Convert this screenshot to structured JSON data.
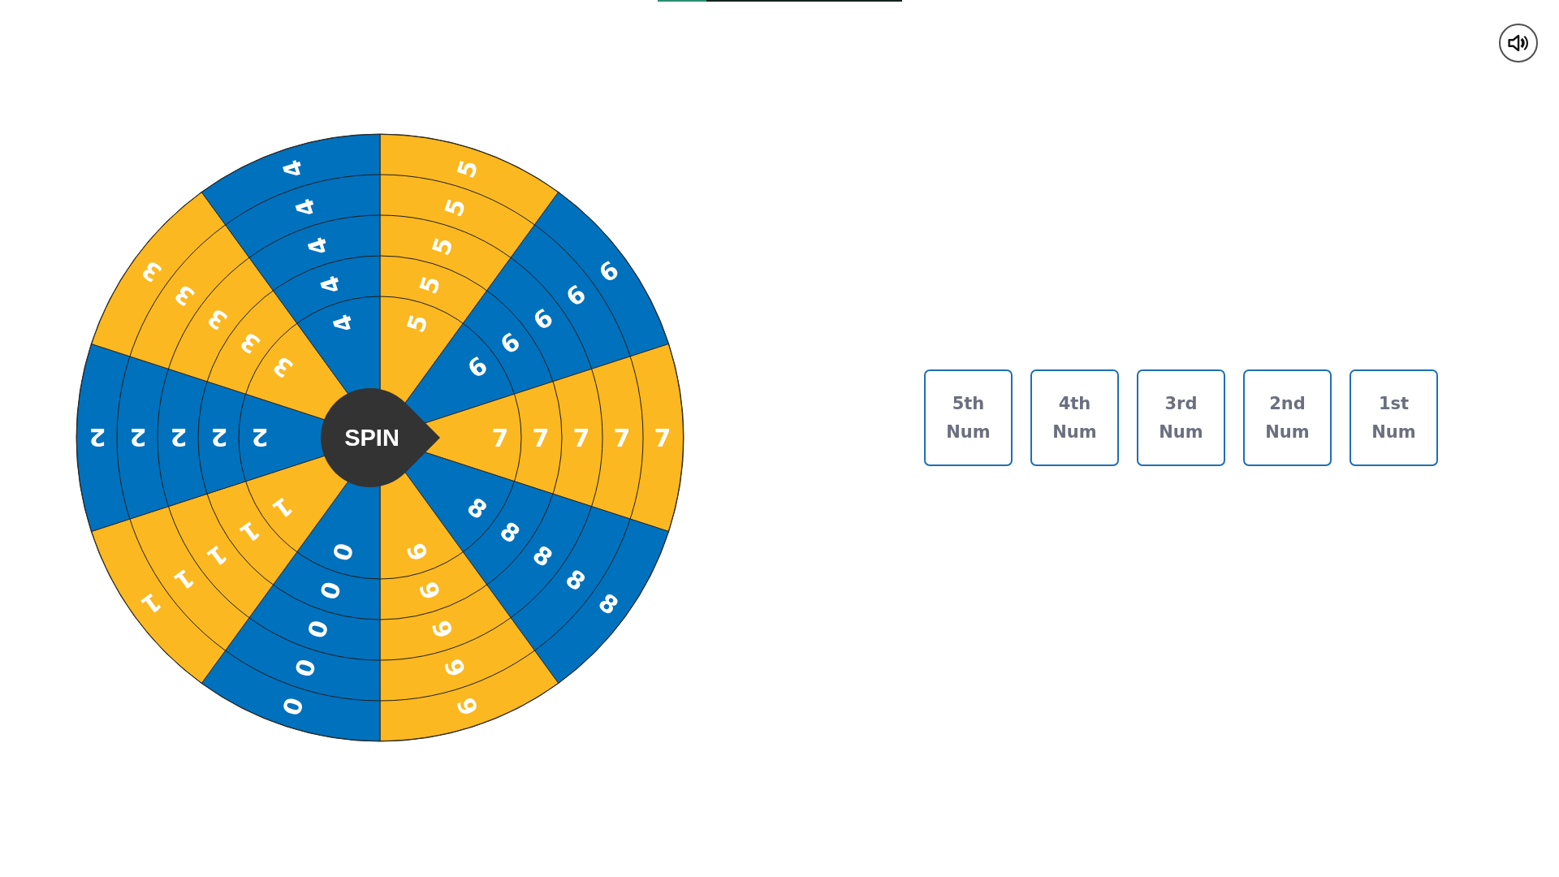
{
  "progress": {
    "level": 0.2
  },
  "sound": {
    "muted": false
  },
  "wheel": {
    "sectors": [
      {
        "color": "#fbb820",
        "numbers": [
          "5",
          "5",
          "5",
          "5",
          "5"
        ]
      },
      {
        "color": "#0071bd",
        "numbers": [
          "6",
          "6",
          "6",
          "6",
          "6"
        ]
      },
      {
        "color": "#fbb820",
        "numbers": [
          "7",
          "7",
          "7",
          "7",
          "7"
        ]
      },
      {
        "color": "#0071bd",
        "numbers": [
          "8",
          "8",
          "8",
          "8",
          "8"
        ]
      },
      {
        "color": "#fbb820",
        "numbers": [
          "9",
          "9",
          "9",
          "9",
          "9"
        ]
      },
      {
        "color": "#0071bd",
        "numbers": [
          "0",
          "0",
          "0",
          "0",
          "0"
        ]
      },
      {
        "color": "#fbb820",
        "numbers": [
          "1",
          "1",
          "1",
          "1",
          "1"
        ]
      },
      {
        "color": "#0071bd",
        "numbers": [
          "2",
          "2",
          "2",
          "2",
          "2"
        ]
      },
      {
        "color": "#fbb820",
        "numbers": [
          "3",
          "3",
          "3",
          "3",
          "3"
        ]
      },
      {
        "color": "#0071bd",
        "numbers": [
          "4",
          "4",
          "4",
          "4",
          "4"
        ]
      }
    ],
    "spin_button": "SPIN"
  },
  "slots": [
    "5th Num",
    "4th Num",
    "3rd Num",
    "2nd Num",
    "1st Num"
  ]
}
